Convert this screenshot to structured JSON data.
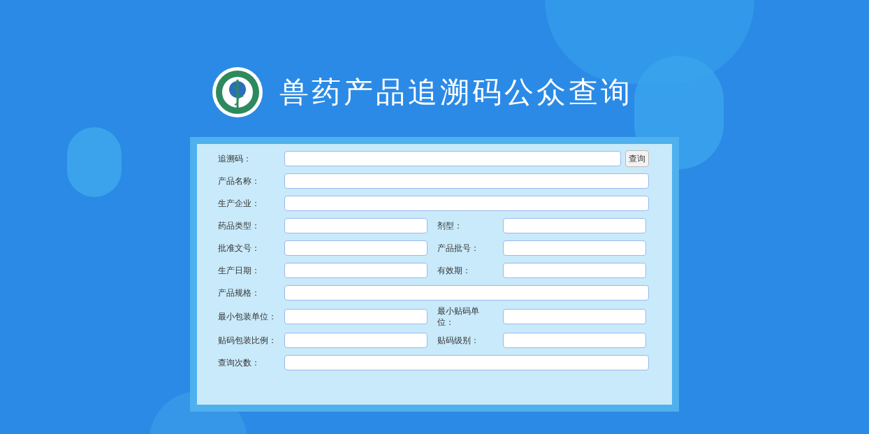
{
  "header": {
    "title": "兽药产品追溯码公众查询"
  },
  "form": {
    "rows": [
      {
        "kind": "search",
        "fields": [
          {
            "label": "追溯码："
          }
        ],
        "button": "查询"
      },
      {
        "kind": "full",
        "fields": [
          {
            "label": "产品名称："
          }
        ]
      },
      {
        "kind": "full",
        "fields": [
          {
            "label": "生产企业："
          }
        ]
      },
      {
        "kind": "pair",
        "fields": [
          {
            "label": "药品类型："
          },
          {
            "label": "剂型："
          }
        ]
      },
      {
        "kind": "pair",
        "fields": [
          {
            "label": "批准文号："
          },
          {
            "label": "产品批号："
          }
        ]
      },
      {
        "kind": "pair",
        "fields": [
          {
            "label": "生产日期："
          },
          {
            "label": "有效期："
          }
        ]
      },
      {
        "kind": "full",
        "fields": [
          {
            "label": "产品规格："
          }
        ]
      },
      {
        "kind": "pair",
        "fields": [
          {
            "label": "最小包装单位："
          },
          {
            "label": "最小贴码单位："
          }
        ]
      },
      {
        "kind": "pair",
        "fields": [
          {
            "label": "贴码包装比例："
          },
          {
            "label": "贴码级别："
          }
        ]
      },
      {
        "kind": "full",
        "fields": [
          {
            "label": "查询次数："
          }
        ]
      }
    ]
  }
}
